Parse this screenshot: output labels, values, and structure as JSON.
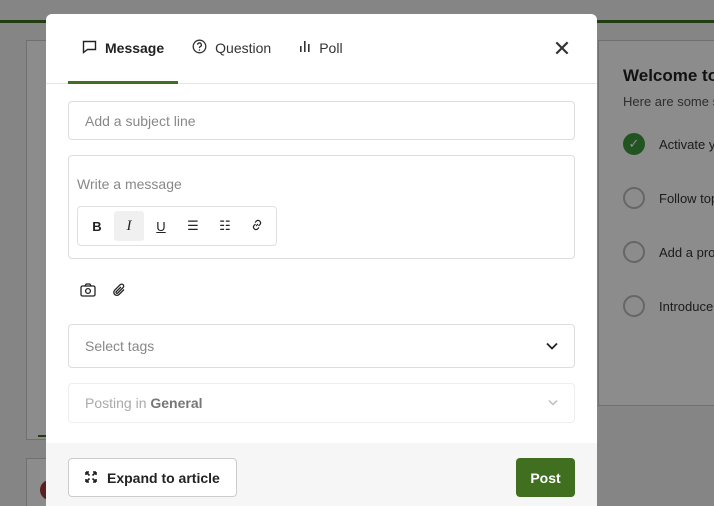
{
  "background": {
    "welcome_title": "Welcome to the community",
    "welcome_subtitle": "Here are some steps to get started",
    "steps": [
      {
        "label": "Activate your account",
        "done": true
      },
      {
        "label": "Follow topics",
        "done": false
      },
      {
        "label": "Add a profile photo",
        "done": false
      },
      {
        "label": "Introduce yourself",
        "done": false
      }
    ]
  },
  "modal": {
    "tabs": [
      {
        "icon": "chat-bubble-icon",
        "glyph": "🗨",
        "label": "Message",
        "active": true
      },
      {
        "icon": "question-circle-icon",
        "glyph": "⓪",
        "label": "Question",
        "active": false
      },
      {
        "icon": "bar-chart-icon",
        "glyph": "ılı",
        "label": "Poll",
        "active": false
      }
    ],
    "close_glyph": "✕",
    "subject_placeholder": "Add a subject line",
    "message_placeholder": "Write a message",
    "toolbar": [
      {
        "name": "bold",
        "glyph": "B"
      },
      {
        "name": "italic",
        "glyph": "I"
      },
      {
        "name": "underline",
        "glyph": "U"
      },
      {
        "name": "bulleted-list",
        "glyph": "☰"
      },
      {
        "name": "numbered-list",
        "glyph": "☷"
      },
      {
        "name": "link",
        "glyph": "🔗"
      }
    ],
    "tags_placeholder": "Select tags",
    "posting_prefix": "Posting in",
    "posting_group": "General",
    "expand_label": "Expand to article",
    "post_label": "Post",
    "accent_color": "#3f6f1f"
  }
}
